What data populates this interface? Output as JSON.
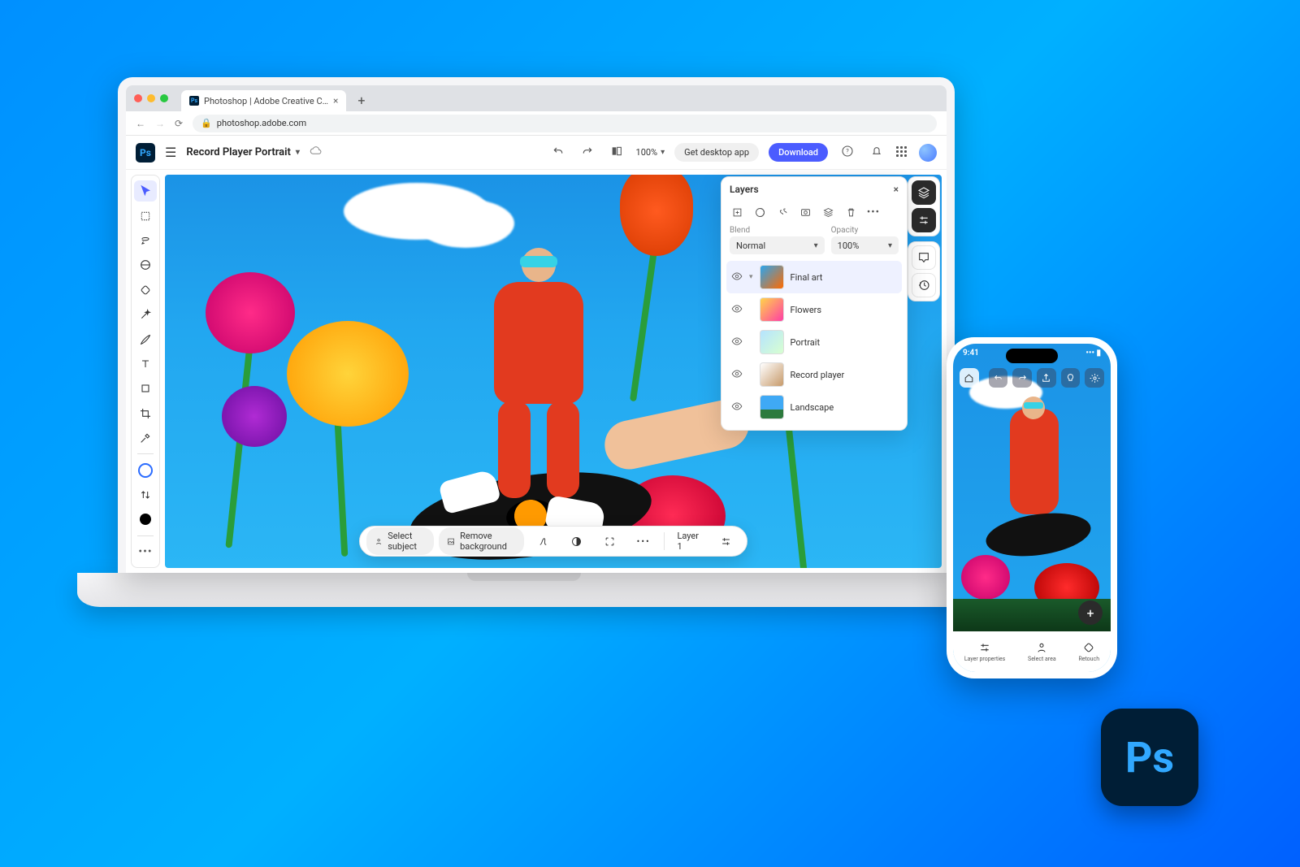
{
  "browser": {
    "tab_title": "Photoshop | Adobe Creative C…",
    "url": "photoshop.adobe.com"
  },
  "header": {
    "doc_title": "Record Player Portrait",
    "zoom": "100%",
    "desktop_btn": "Get desktop app",
    "download_btn": "Download"
  },
  "layers_panel": {
    "title": "Layers",
    "blend_label": "Blend",
    "blend_value": "Normal",
    "opacity_label": "Opacity",
    "opacity_value": "100%",
    "items": [
      {
        "name": "Final art"
      },
      {
        "name": "Flowers"
      },
      {
        "name": "Portrait"
      },
      {
        "name": "Record player"
      },
      {
        "name": "Landscape"
      }
    ]
  },
  "context_bar": {
    "select_subject": "Select subject",
    "remove_bg": "Remove background",
    "layer_label": "Layer 1"
  },
  "phone": {
    "time": "9:41",
    "bottom": {
      "layer_props": "Layer properties",
      "select_area": "Select area",
      "retouch": "Retouch"
    }
  },
  "ps_icon_text": "Ps"
}
